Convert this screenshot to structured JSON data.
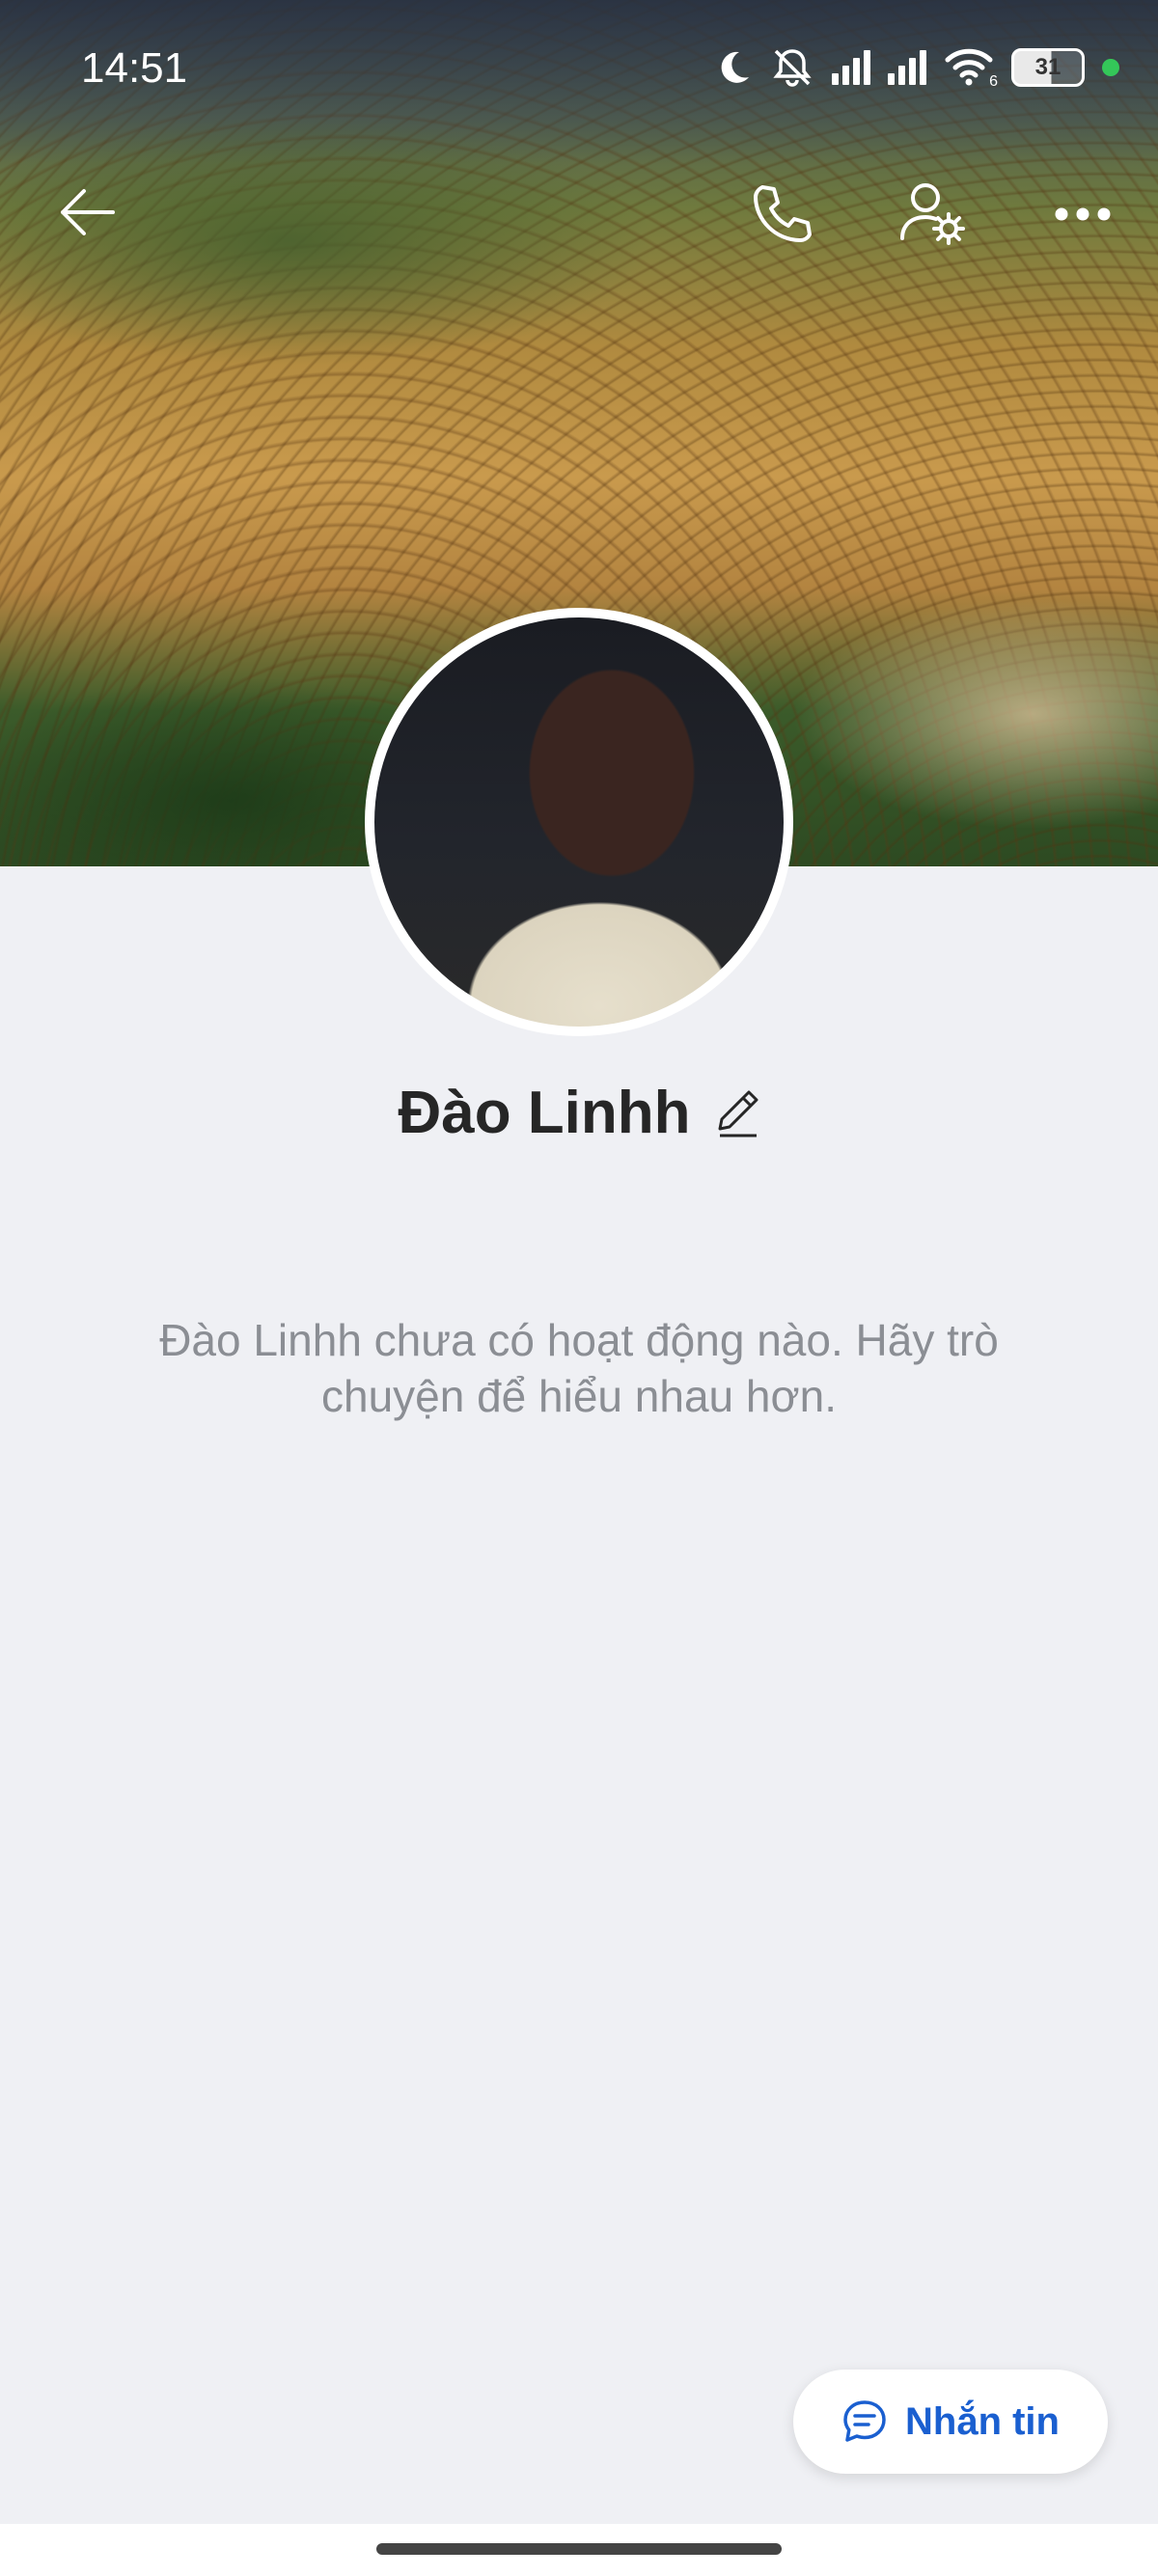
{
  "status_bar": {
    "time": "14:51",
    "battery": "31",
    "network_label": "6"
  },
  "nav": {
    "back_icon": "arrow-left-icon",
    "call_icon": "phone-icon",
    "settings_icon": "user-settings-icon",
    "more_icon": "more-dots-icon"
  },
  "profile": {
    "name": "Đào Linhh",
    "edit_icon": "pencil-icon"
  },
  "activity": {
    "empty_message": "Đào Linhh chưa có hoạt động nào. Hãy trò chuyện để hiểu nhau hơn."
  },
  "actions": {
    "message_label": "Nhắn tin",
    "message_icon": "chat-bubble-icon"
  },
  "colors": {
    "accent": "#1a5fd0",
    "background": "#eff0f4",
    "status_dot": "#34c759"
  }
}
